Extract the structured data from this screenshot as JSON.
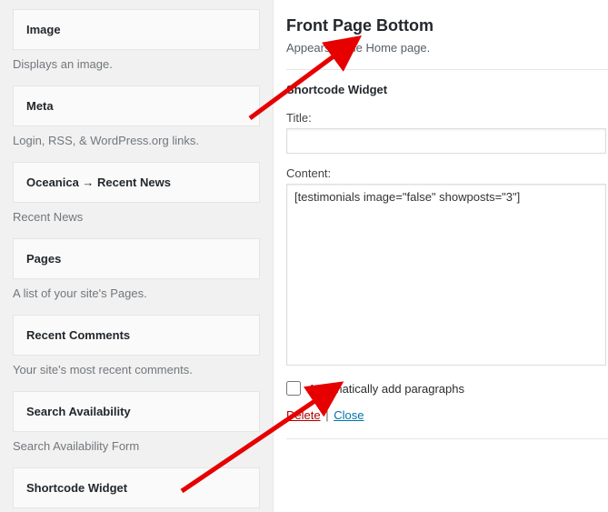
{
  "widgets": [
    {
      "name": "Image",
      "desc": "Displays an image."
    },
    {
      "name": "Meta",
      "desc": "Login, RSS, & WordPress.org links."
    },
    {
      "name": "Oceanica → Recent News",
      "desc": "Recent News"
    },
    {
      "name": "Pages",
      "desc": "A list of your site's Pages."
    },
    {
      "name": "Recent Comments",
      "desc": "Your site's most recent comments."
    },
    {
      "name": "Search Availability",
      "desc": "Search Availability Form"
    },
    {
      "name": "Shortcode Widget",
      "desc": ""
    }
  ],
  "area": {
    "title": "Front Page Bottom",
    "desc": "Appears in the Home page."
  },
  "widget_form": {
    "header": "Shortcode Widget",
    "title_label": "Title:",
    "title_value": "",
    "content_label": "Content:",
    "content_value": "[testimonials image=\"false\" showposts=\"3\"]",
    "autop_label": "Automatically add paragraphs",
    "autop_checked": false,
    "delete_label": "Delete",
    "close_label": "Close"
  }
}
